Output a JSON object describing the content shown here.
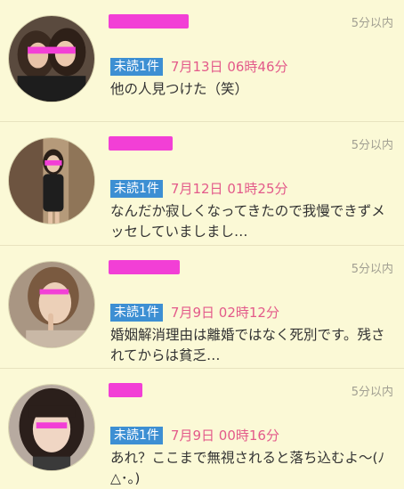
{
  "threads": [
    {
      "name": "",
      "time_ago": "5分以内",
      "unread_badge": "未読1件",
      "date": "7月13日 06時46分",
      "message": "他の人見つけた（笑）",
      "avatar_icon": "user-photo-two-women"
    },
    {
      "name": "",
      "time_ago": "5分以内",
      "unread_badge": "未読1件",
      "date": "7月12日 01時25分",
      "message": "なんだか寂しくなってきたので我慢できずメッセしていましまし…",
      "avatar_icon": "user-photo-mirror-selfie"
    },
    {
      "name": "",
      "time_ago": "5分以内",
      "unread_badge": "未読1件",
      "date": "7月9日 02時12分",
      "message": "婚姻解消理由は離婚ではなく死別です。残されてからは貧乏…",
      "avatar_icon": "user-photo-woman-shush"
    },
    {
      "name": "",
      "time_ago": "5分以内",
      "unread_badge": "未読1件",
      "date": "7月9日 00時16分",
      "message": "あれ？ここまで無視されると落ち込むよ〜(ﾉ△･｡)",
      "avatar_icon": "user-photo-woman-portrait"
    }
  ],
  "colors": {
    "background": "#fbf9d6",
    "badge": "#3d8fd3",
    "date": "#e35a8a",
    "time": "#a19f92",
    "redaction": "#f23fd6"
  }
}
